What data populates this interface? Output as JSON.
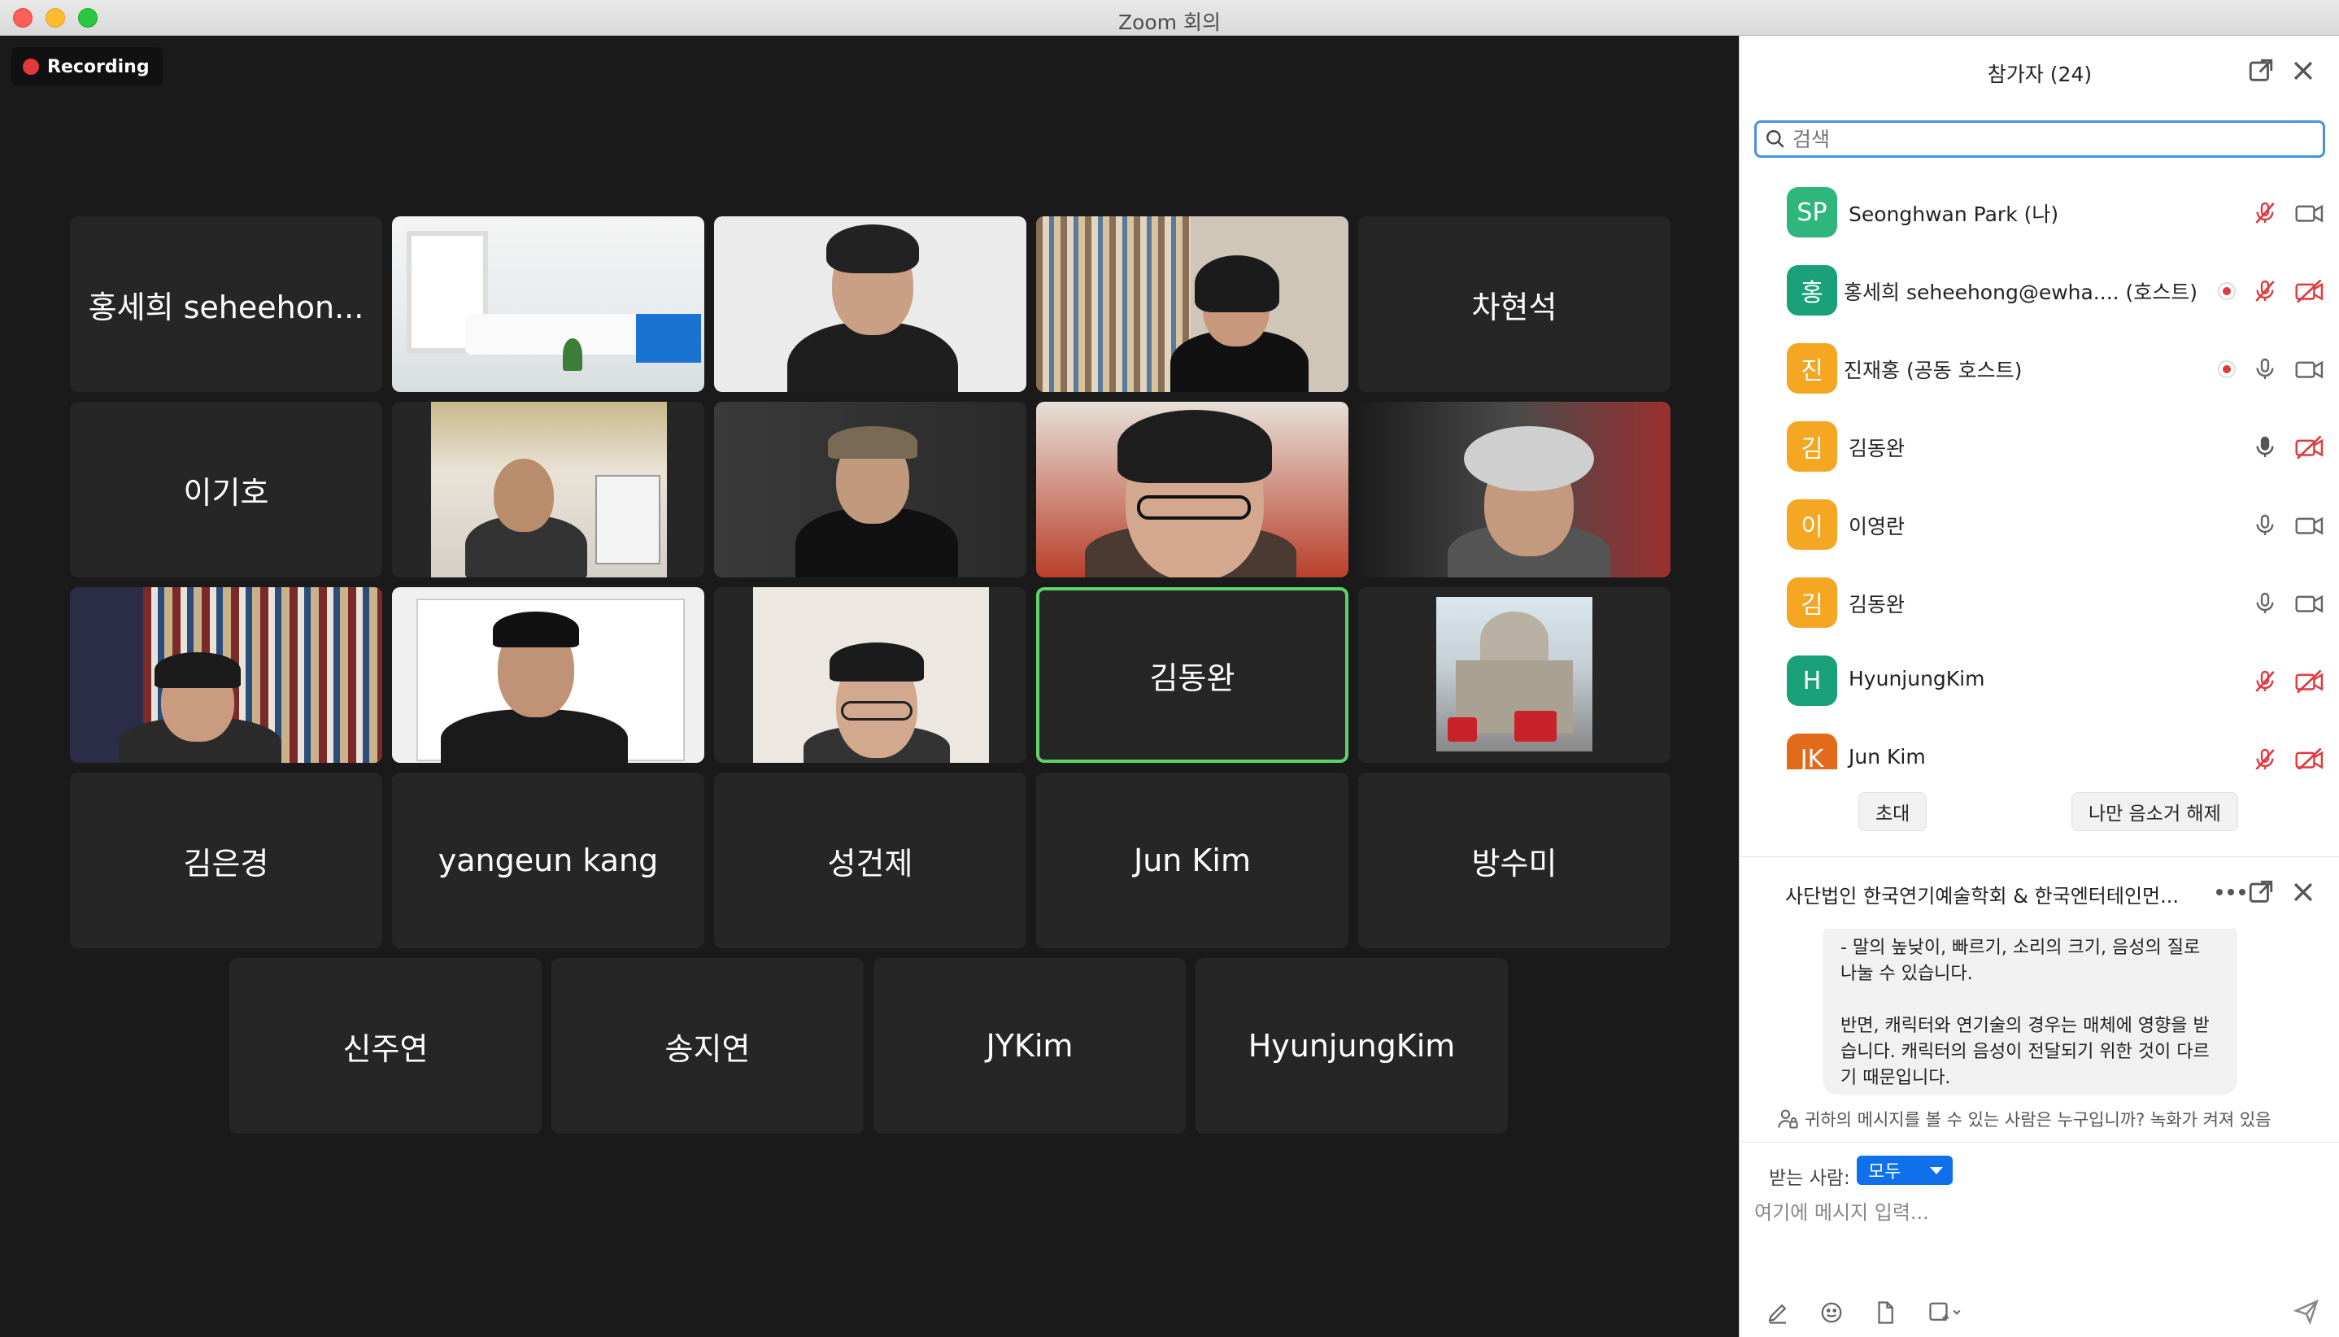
{
  "window": {
    "title": "Zoom 회의"
  },
  "recording": {
    "label": "Recording"
  },
  "tiles": [
    {
      "name": "홍세희 seheehon...",
      "video": false
    },
    {
      "name": "",
      "video": true
    },
    {
      "name": "",
      "video": true
    },
    {
      "name": "",
      "video": true
    },
    {
      "name": "차현석",
      "video": false
    },
    {
      "name": "이기호",
      "video": false
    },
    {
      "name": "",
      "video": true
    },
    {
      "name": "",
      "video": true
    },
    {
      "name": "",
      "video": true
    },
    {
      "name": "",
      "video": true
    },
    {
      "name": "",
      "video": true
    },
    {
      "name": "",
      "video": true
    },
    {
      "name": "",
      "video": true
    },
    {
      "name": "김동완",
      "video": false,
      "active": true
    },
    {
      "name": "",
      "video": true
    },
    {
      "name": "김은경",
      "video": false
    },
    {
      "name": "yangeun kang",
      "video": false
    },
    {
      "name": "성건제",
      "video": false
    },
    {
      "name": "Jun Kim",
      "video": false
    },
    {
      "name": "방수미",
      "video": false
    },
    {
      "name": "신주연",
      "video": false
    },
    {
      "name": "송지연",
      "video": false
    },
    {
      "name": "JYKim",
      "video": false
    },
    {
      "name": "HyunjungKim",
      "video": false
    }
  ],
  "participants_panel": {
    "title": "참가자 (24)",
    "search_placeholder": "검색",
    "participants": [
      {
        "initials": "SP",
        "name": "Seonghwan Park (나)",
        "color": "#2eb67d",
        "mic": "muted",
        "video": "on",
        "recording": false
      },
      {
        "initials": "홍",
        "name": "홍세희 seheehong@ewha.... (호스트)",
        "color": "#1aa17a",
        "mic": "muted",
        "video": "off",
        "recording": true
      },
      {
        "initials": "진",
        "name": "진재홍 (공동 호스트)",
        "color": "#f5a623",
        "mic": "on",
        "video": "on",
        "recording": true
      },
      {
        "initials": "김",
        "name": "김동완",
        "color": "#f5a623",
        "mic": "active",
        "video": "off",
        "recording": false
      },
      {
        "initials": "이",
        "name": "이영란",
        "color": "#f5a623",
        "mic": "on",
        "video": "on",
        "recording": false
      },
      {
        "initials": "김",
        "name": "김동완",
        "color": "#f5a623",
        "mic": "on",
        "video": "on",
        "recording": false
      },
      {
        "initials": "H",
        "name": "HyunjungKim",
        "color": "#1aa17a",
        "mic": "muted",
        "video": "off",
        "recording": false
      },
      {
        "initials": "JK",
        "name": "Jun Kim",
        "color": "#e26a1b",
        "mic": "muted",
        "video": "off",
        "recording": false
      }
    ],
    "invite_label": "초대",
    "unmute_self_label": "나만 음소거 해제"
  },
  "chat": {
    "title": "사단법인 한국연기예술학회 & 한국엔터테인먼...",
    "message_lines": [
      "- 말의 높낮이, 빠르기, 소리의 크기, 음성의 질로 나눌 수 있습니다.",
      "반면, 캐릭터와 연기술의 경우는 매체에 영향을 받습니다. 캐릭터의 음성이 전달되기 위한 것이 다르기 때문입니다."
    ],
    "notice": "귀하의 메시지를 볼 수 있는 사람은 누구입니까? 녹화가 켜져 있음",
    "to_label": "받는 사람:",
    "to_value": "모두",
    "input_placeholder": "여기에 메시지 입력..."
  }
}
